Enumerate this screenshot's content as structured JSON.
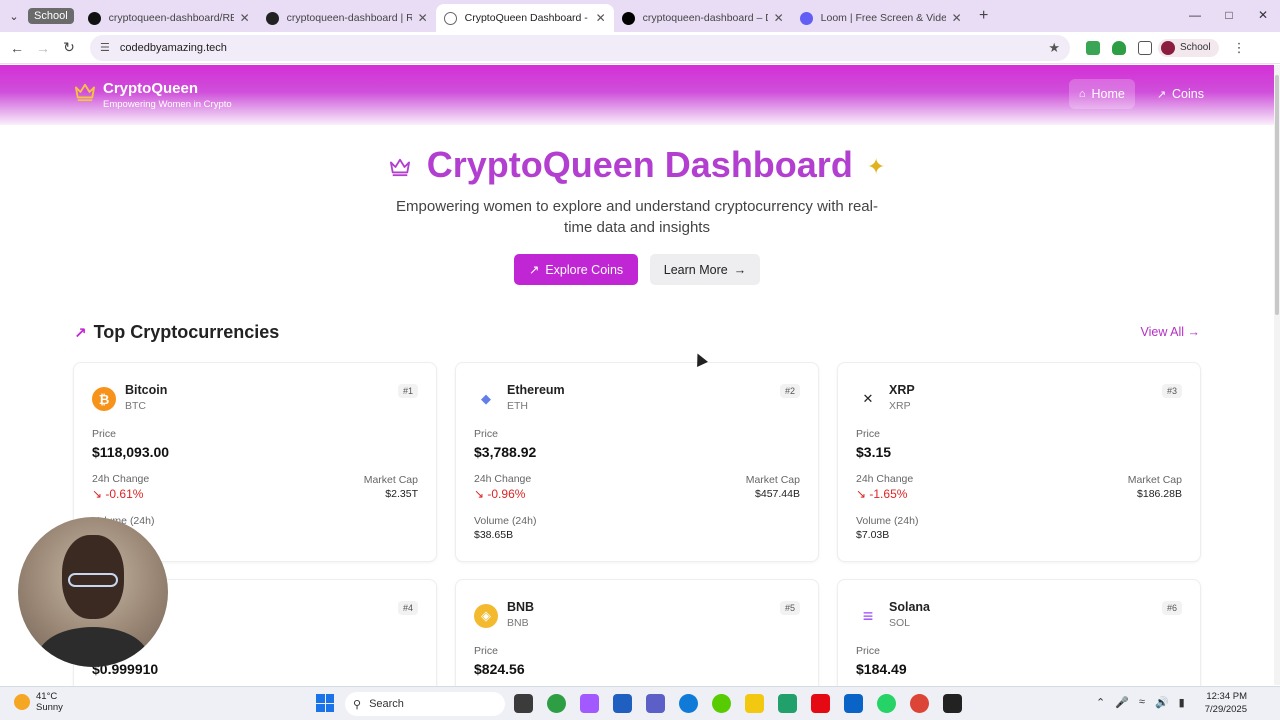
{
  "browser": {
    "profile_chip": "School",
    "tabs": [
      {
        "title": "cryptoqueen-dashboard/READM",
        "icon": "github-icon",
        "color": "#111111"
      },
      {
        "title": "cryptoqueen-dashboard | Railw",
        "icon": "railway-icon",
        "color": "#222222"
      },
      {
        "title": "CryptoQueen Dashboard - Emp",
        "icon": "globe-icon",
        "color": "#666666"
      },
      {
        "title": "cryptoqueen-dashboard – Depl",
        "icon": "vercel-icon",
        "color": "#000000"
      },
      {
        "title": "Loom | Free Screen & Video Re",
        "icon": "loom-icon",
        "color": "#625df5"
      }
    ],
    "url": "codedbyamazing.tech",
    "profile_label": "School"
  },
  "site": {
    "brand_title": "CryptoQueen",
    "brand_subtitle": "Empowering Women in Crypto",
    "nav": [
      {
        "label": "Home",
        "active": true
      },
      {
        "label": "Coins",
        "active": false
      }
    ],
    "hero_title": "CryptoQueen Dashboard",
    "hero_subtitle": "Empowering women to explore and understand cryptocurrency with real-time data and insights",
    "explore_label": "Explore Coins",
    "learn_label": "Learn More",
    "section_title": "Top Cryptocurrencies",
    "view_all_label": "View All →",
    "labels": {
      "price": "Price",
      "change": "24h Change",
      "market_cap": "Market Cap",
      "volume": "Volume (24h)"
    },
    "coins": [
      {
        "name": "Bitcoin",
        "symbol": "BTC",
        "rank": "#1",
        "price": "$118,093.00",
        "change": "-0.61%",
        "market_cap": "$2.35T",
        "volume": "",
        "logo_color": "#f7931a",
        "logo_glyph": "₿"
      },
      {
        "name": "Ethereum",
        "symbol": "ETH",
        "rank": "#2",
        "price": "$3,788.92",
        "change": "-0.96%",
        "market_cap": "$457.44B",
        "volume": "$38.65B",
        "logo_color": "#ffffff",
        "logo_glyph": "◆"
      },
      {
        "name": "XRP",
        "symbol": "XRP",
        "rank": "#3",
        "price": "$3.15",
        "change": "-1.65%",
        "market_cap": "$186.28B",
        "volume": "$7.03B",
        "logo_color": "#ffffff",
        "logo_glyph": "✕"
      },
      {
        "name": "",
        "symbol": "",
        "rank": "#4",
        "price": "$0.999910",
        "change": "",
        "market_cap": "",
        "volume": "",
        "logo_color": "#ffffff",
        "logo_glyph": ""
      },
      {
        "name": "BNB",
        "symbol": "BNB",
        "rank": "#5",
        "price": "$824.56",
        "change": "",
        "market_cap": "",
        "volume": "",
        "logo_color": "#f3ba2f",
        "logo_glyph": "◈"
      },
      {
        "name": "Solana",
        "symbol": "SOL",
        "rank": "#6",
        "price": "$184.49",
        "change": "",
        "market_cap": "",
        "volume": "",
        "logo_color": "#ffffff",
        "logo_glyph": "≡"
      }
    ]
  },
  "taskbar": {
    "weather_temp": "41°C",
    "weather_desc": "Sunny",
    "search_label": "Search",
    "time": "12:34 PM",
    "date": "7/29/2025"
  }
}
